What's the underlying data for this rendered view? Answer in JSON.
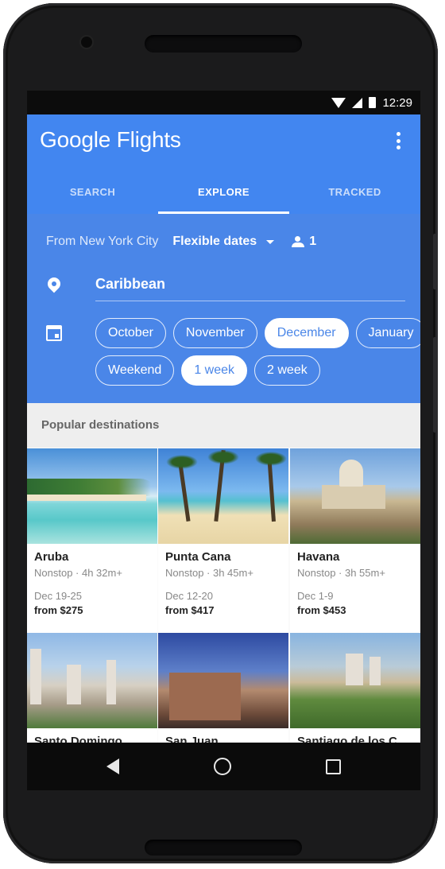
{
  "status_bar": {
    "time": "12:29",
    "icons": [
      "wifi-icon",
      "signal-icon",
      "battery-icon"
    ]
  },
  "app": {
    "title": "Google Flights",
    "menu_icon": "more-vert-icon"
  },
  "tabs": [
    {
      "label": "SEARCH",
      "active": false
    },
    {
      "label": "EXPLORE",
      "active": true
    },
    {
      "label": "TRACKED",
      "active": false
    }
  ],
  "filters": {
    "origin": "From New York City",
    "dates": "Flexible dates",
    "passengers": "1",
    "destination": "Caribbean",
    "months": [
      {
        "label": "October",
        "selected": false
      },
      {
        "label": "November",
        "selected": false
      },
      {
        "label": "December",
        "selected": true
      },
      {
        "label": "January",
        "selected": false
      }
    ],
    "durations": [
      {
        "label": "Weekend",
        "selected": false
      },
      {
        "label": "1 week",
        "selected": true
      },
      {
        "label": "2 week",
        "selected": false
      }
    ]
  },
  "section": {
    "title": "Popular destinations"
  },
  "destinations": [
    {
      "city": "Aruba",
      "flight": "Nonstop · 4h 32m+",
      "dates": "Dec 19-25",
      "price": "from $275"
    },
    {
      "city": "Punta Cana",
      "flight": "Nonstop · 3h 45m+",
      "dates": "Dec 12-20",
      "price": "from $417"
    },
    {
      "city": "Havana",
      "flight": "Nonstop · 3h 55m+",
      "dates": "Dec 1-9",
      "price": "from $453"
    },
    {
      "city": "Santo Domingo",
      "flight": "",
      "dates": "",
      "price": ""
    },
    {
      "city": "San Juan",
      "flight": "",
      "dates": "",
      "price": ""
    },
    {
      "city": "Santiago de los C",
      "flight": "",
      "dates": "",
      "price": ""
    }
  ],
  "colors": {
    "primary": "#4286f0",
    "filters_bg": "#4a86e8",
    "selected_chip_text": "#4a86e8"
  },
  "nav_bar": {
    "icons": [
      "back-icon",
      "home-icon",
      "recents-icon"
    ]
  }
}
